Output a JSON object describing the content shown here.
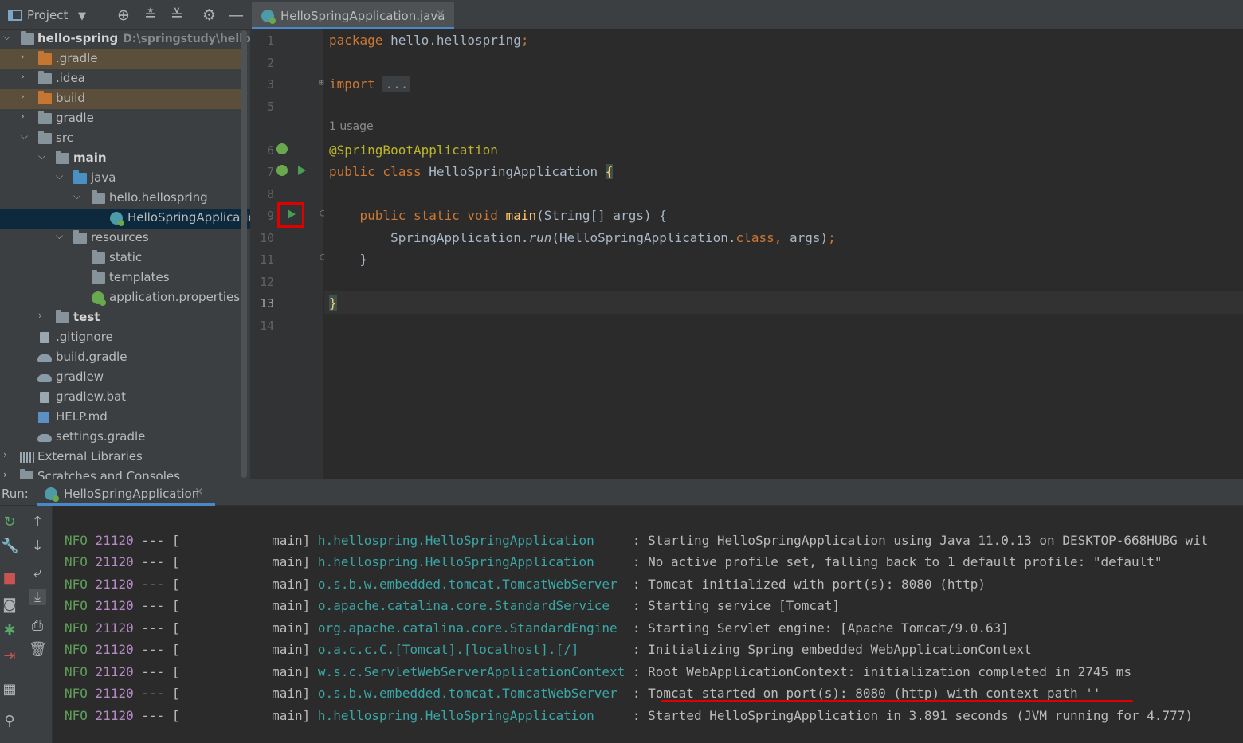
{
  "colors": {
    "accent_tab_underline": "#4a88c7",
    "highlight_red": "#e00000",
    "keyword": "#cc7832",
    "annotation": "#bbb529",
    "method": "#ffc66d",
    "logger": "#3aa6a6",
    "log_level": "#5f9e5a",
    "pid": "#b589c4"
  },
  "project_panel": {
    "title": "Project",
    "toolbar_icons": [
      "dropdown-icon",
      "locate-icon",
      "expand-all-icon",
      "collapse-all-icon",
      "gear-icon",
      "minimize-icon"
    ],
    "tree": [
      {
        "label": "hello-spring",
        "sub": "D:\\springstudy\\hello-spr",
        "icon": "module-folder-icon"
      },
      {
        "label": ".gradle",
        "icon": "folder-orange-icon"
      },
      {
        "label": ".idea",
        "icon": "folder-icon"
      },
      {
        "label": "build",
        "icon": "folder-orange-icon"
      },
      {
        "label": "gradle",
        "icon": "folder-icon"
      },
      {
        "label": "src",
        "icon": "folder-icon"
      },
      {
        "label": "main",
        "icon": "source-folder-icon"
      },
      {
        "label": "java",
        "icon": "folder-blue-icon"
      },
      {
        "label": "hello.hellospring",
        "icon": "package-icon"
      },
      {
        "label": "HelloSpringApplication",
        "icon": "spring-class-icon"
      },
      {
        "label": "resources",
        "icon": "resources-folder-icon"
      },
      {
        "label": "static",
        "icon": "folder-icon"
      },
      {
        "label": "templates",
        "icon": "folder-icon"
      },
      {
        "label": "application.properties",
        "icon": "spring-properties-icon"
      },
      {
        "label": "test",
        "icon": "source-folder-icon"
      },
      {
        "label": ".gitignore",
        "icon": "file-icon"
      },
      {
        "label": "build.gradle",
        "icon": "gradle-icon"
      },
      {
        "label": "gradlew",
        "icon": "gradle-icon"
      },
      {
        "label": "gradlew.bat",
        "icon": "file-icon"
      },
      {
        "label": "HELP.md",
        "icon": "markdown-icon"
      },
      {
        "label": "settings.gradle",
        "icon": "gradle-icon"
      },
      {
        "label": "External Libraries",
        "icon": "libraries-icon"
      },
      {
        "label": "Scratches and Consoles",
        "icon": "scratches-icon"
      }
    ]
  },
  "editor": {
    "tab_label": "HelloSpringApplication.java",
    "line_numbers": [
      "1",
      "2",
      "3",
      "5",
      "6",
      "7",
      "8",
      "9",
      "10",
      "11",
      "12",
      "13",
      "14"
    ],
    "usage_hint": "1 usage",
    "code": {
      "l1_kw": "package",
      "l1_rest": " hello.hellospring",
      "l1_semi": ";",
      "l3_kw": "import",
      "l3_fold": "...",
      "l6_ann": "@SpringBootApplication",
      "l7_kw": "public class",
      "l7_name": " HelloSpringApplication ",
      "l7_brace": "{",
      "l9_kw": "    public static void",
      "l9_fn": " main",
      "l9_rest": "(String[] args) {",
      "l10_a": "        SpringApplication.",
      "l10_run": "run",
      "l10_b": "(HelloSpringApplication.",
      "l10_kw": "class",
      "l10_comma": ",",
      "l10_c": " args)",
      "l10_semi": ";",
      "l11": "    }",
      "l13": "}"
    }
  },
  "run_panel": {
    "label": "Run:",
    "tab_label": "HelloSpringApplication",
    "toolbar_icons": [
      "rerun-icon",
      "wrench-icon",
      "stop-icon",
      "camera-icon",
      "debug-bug-icon",
      "exit-icon",
      "layout-icon",
      "pin-icon",
      "up-arrow-icon",
      "down-arrow-icon",
      "soft-wrap-icon",
      "scroll-to-end-icon",
      "print-icon",
      "trash-icon"
    ],
    "log_lines": [
      {
        "level": "NFO",
        "pid": "21120",
        "sep": " --- [",
        "thread": "main]",
        "logger": "h.hellospring.HelloSpringApplication",
        "msg": ": Starting HelloSpringApplication using Java 11.0.13 on DESKTOP-668HUBG wit"
      },
      {
        "level": "NFO",
        "pid": "21120",
        "sep": " --- [",
        "thread": "main]",
        "logger": "h.hellospring.HelloSpringApplication",
        "msg": ": No active profile set, falling back to 1 default profile: \"default\""
      },
      {
        "level": "NFO",
        "pid": "21120",
        "sep": " --- [",
        "thread": "main]",
        "logger": "o.s.b.w.embedded.tomcat.TomcatWebServer",
        "msg": ": Tomcat initialized with port(s): 8080 (http)"
      },
      {
        "level": "NFO",
        "pid": "21120",
        "sep": " --- [",
        "thread": "main]",
        "logger": "o.apache.catalina.core.StandardService",
        "msg": ": Starting service [Tomcat]"
      },
      {
        "level": "NFO",
        "pid": "21120",
        "sep": " --- [",
        "thread": "main]",
        "logger": "org.apache.catalina.core.StandardEngine",
        "msg": ": Starting Servlet engine: [Apache Tomcat/9.0.63]"
      },
      {
        "level": "NFO",
        "pid": "21120",
        "sep": " --- [",
        "thread": "main]",
        "logger": "o.a.c.c.C.[Tomcat].[localhost].[/]",
        "msg": ": Initializing Spring embedded WebApplicationContext"
      },
      {
        "level": "NFO",
        "pid": "21120",
        "sep": " --- [",
        "thread": "main]",
        "logger": "w.s.c.ServletWebServerApplicationContext",
        "msg": ": Root WebApplicationContext: initialization completed in 2745 ms"
      },
      {
        "level": "NFO",
        "pid": "21120",
        "sep": " --- [",
        "thread": "main]",
        "logger": "o.s.b.w.embedded.tomcat.TomcatWebServer",
        "msg": ": Tomcat started on port(s): 8080 (http) with context path ''"
      },
      {
        "level": "NFO",
        "pid": "21120",
        "sep": " --- [",
        "thread": "main]",
        "logger": "h.hellospring.HelloSpringApplication",
        "msg": ": Started HelloSpringApplication in 3.891 seconds (JVM running for 4.777)"
      }
    ]
  }
}
